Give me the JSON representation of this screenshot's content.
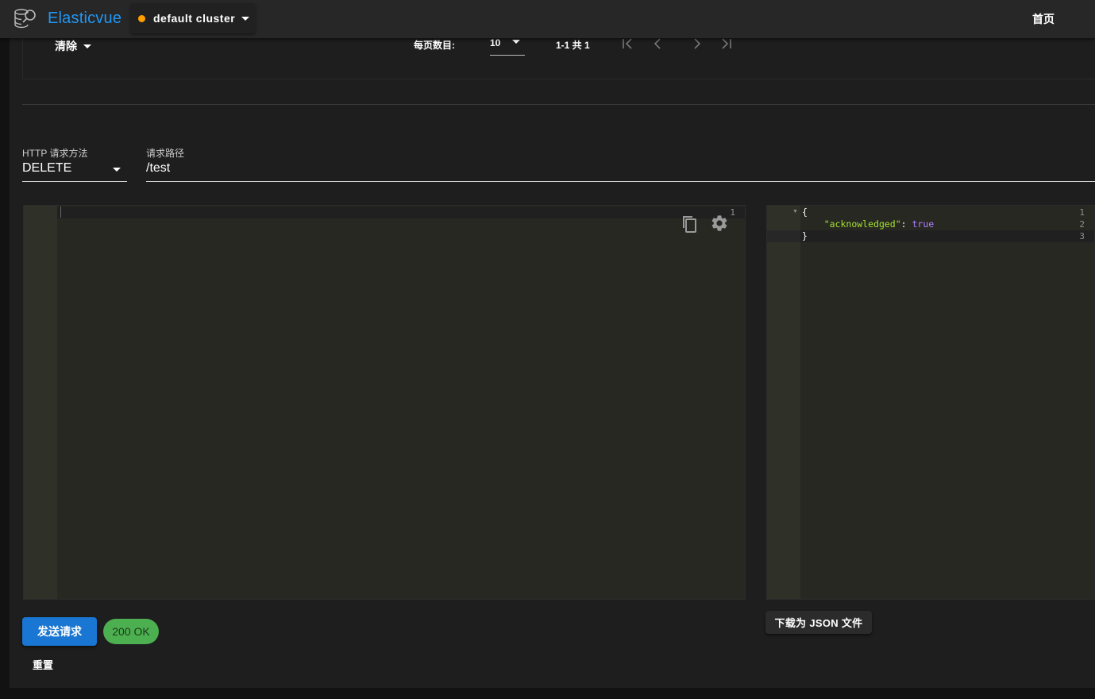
{
  "appbar": {
    "brand": "Elasticvue",
    "cluster_name": "default cluster",
    "cluster_status_color": "#ffa000",
    "home_label": "首页"
  },
  "table_footer": {
    "clear_label": "清除",
    "rows_per_page_label": "每页数目:",
    "rows_per_page_value": "10",
    "range_text": "1-1 共 1",
    "pager_icons": [
      "first-page-icon",
      "prev-page-icon",
      "next-page-icon",
      "last-page-icon"
    ]
  },
  "request": {
    "method_label": "HTTP 请求方法",
    "method_value": "DELETE",
    "path_label": "请求路径",
    "path_value": "/test"
  },
  "request_editor": {
    "line_numbers": [
      "1"
    ],
    "icons": [
      "copy-icon",
      "settings-icon"
    ]
  },
  "response_editor": {
    "line_numbers": [
      "1",
      "2",
      "3"
    ],
    "lines": [
      "{",
      "    \"acknowledged\": true",
      "}"
    ]
  },
  "actions": {
    "send_label": "发送请求",
    "status_label": "200 OK",
    "reset_label": "重置",
    "download_label": "下载为 JSON 文件"
  },
  "colors": {
    "brand": "#2196f3",
    "primary_button": "#1976d2",
    "status_chip": "#4caf50",
    "editor_bg": "#272822"
  }
}
